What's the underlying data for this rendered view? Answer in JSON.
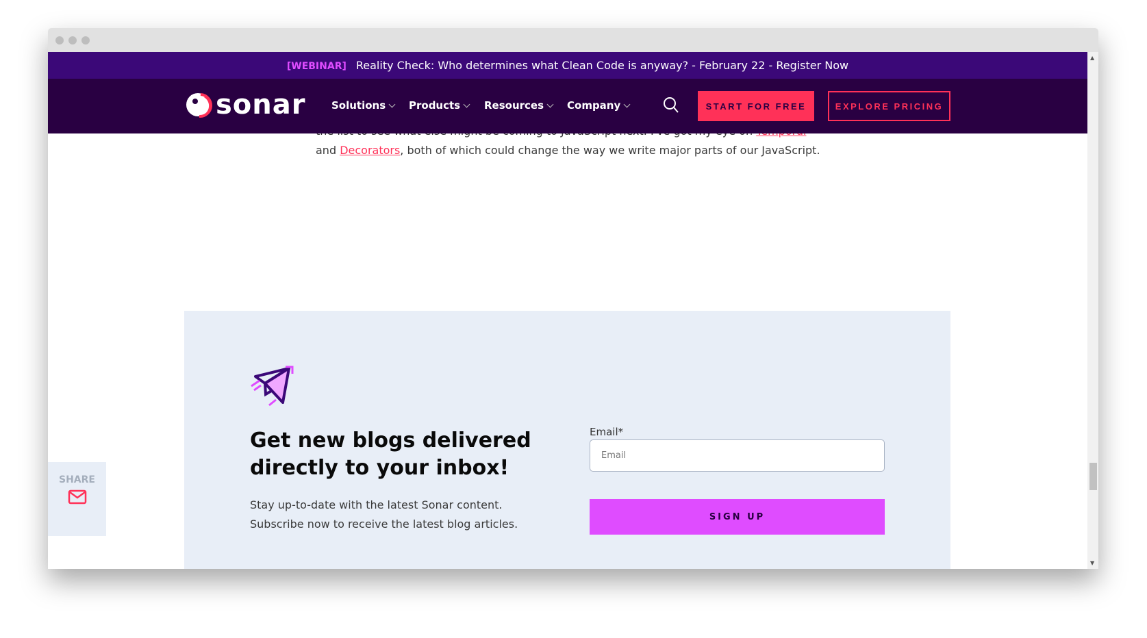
{
  "banner": {
    "tag": "[WEBINAR]",
    "text": "Reality Check: Who determines what Clean Code is anyway? - February 22 - Register Now"
  },
  "nav": {
    "logo": "sonar",
    "items": [
      {
        "label": "Solutions"
      },
      {
        "label": "Products"
      },
      {
        "label": "Resources"
      },
      {
        "label": "Company"
      }
    ],
    "search_icon": "search-icon",
    "start_label": "START FOR FREE",
    "pricing_label": "EXPLORE PRICING"
  },
  "article": {
    "line1_pre": "the list to see what else might be coming to JavaScript next. I've got my eye on ",
    "link1": "Temporal",
    "line2_pre": "and ",
    "link2": "Decorators",
    "line2_post": ", both of which could change the way we write major parts of our JavaScript."
  },
  "signup": {
    "heading": "Get new blogs delivered directly to your inbox!",
    "description": "Stay up-to-date with the latest Sonar content. Subscribe now to receive the latest blog articles.",
    "email_label": "Email*",
    "email_placeholder": "Email",
    "email_value": "",
    "button": "SIGN UP"
  },
  "share": {
    "label": "SHARE",
    "icon": "mail-icon"
  },
  "colors": {
    "banner": "#3b0878",
    "nav": "#290042",
    "accent": "#ff3158",
    "magenta": "#df4cff",
    "panel": "#e8eef7"
  }
}
